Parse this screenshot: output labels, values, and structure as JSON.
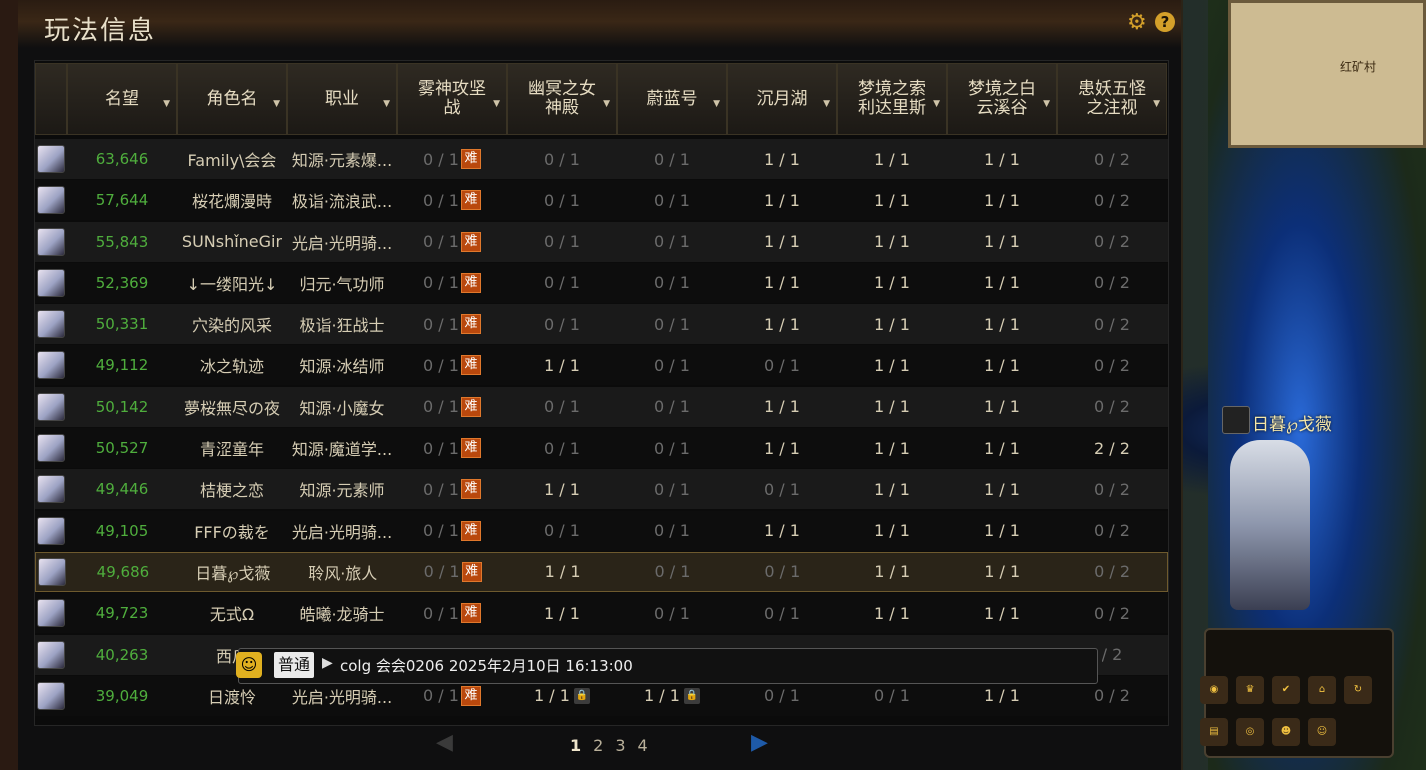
{
  "panel": {
    "title": "玩法信息",
    "gear_icon": "gear-icon",
    "help_label": "?"
  },
  "columns": [
    {
      "label": "",
      "sortable": false
    },
    {
      "label": "名望",
      "sortable": true
    },
    {
      "label": "角色名",
      "sortable": true
    },
    {
      "label": "职业",
      "sortable": true
    },
    {
      "label": "雾神攻坚战",
      "sortable": true
    },
    {
      "label": "幽冥之女神殿",
      "sortable": true
    },
    {
      "label": "蔚蓝号",
      "sortable": true
    },
    {
      "label": "沉月湖",
      "sortable": true
    },
    {
      "label": "梦境之索利达里斯",
      "sortable": true
    },
    {
      "label": "梦境之白云溪谷",
      "sortable": true
    },
    {
      "label": "患妖五怪之注视",
      "sortable": true
    }
  ],
  "rows": [
    {
      "fame": "63,646",
      "name": "Family\\会会",
      "job": "知源·元素爆...",
      "c1": "0 / 1",
      "c2": "0 / 1",
      "c3": "0 / 1",
      "c4": "1 / 1",
      "c5": "1 / 1",
      "c6": "1 / 1",
      "c7": "0 / 2"
    },
    {
      "fame": "57,644",
      "name": "桜花爛漫時",
      "job": "极诣·流浪武...",
      "c1": "0 / 1",
      "c2": "0 / 1",
      "c3": "0 / 1",
      "c4": "1 / 1",
      "c5": "1 / 1",
      "c6": "1 / 1",
      "c7": "0 / 2"
    },
    {
      "fame": "55,843",
      "name": "SUNshǐneGir",
      "job": "光启·光明骑...",
      "c1": "0 / 1",
      "c2": "0 / 1",
      "c3": "0 / 1",
      "c4": "1 / 1",
      "c5": "1 / 1",
      "c6": "1 / 1",
      "c7": "0 / 2"
    },
    {
      "fame": "52,369",
      "name": "↓一缕阳光↓",
      "job": "归元·气功师",
      "c1": "0 / 1",
      "c2": "0 / 1",
      "c3": "0 / 1",
      "c4": "1 / 1",
      "c5": "1 / 1",
      "c6": "1 / 1",
      "c7": "0 / 2"
    },
    {
      "fame": "50,331",
      "name": "穴染的风采",
      "job": "极诣·狂战士",
      "c1": "0 / 1",
      "c2": "0 / 1",
      "c3": "0 / 1",
      "c4": "1 / 1",
      "c5": "1 / 1",
      "c6": "1 / 1",
      "c7": "0 / 2"
    },
    {
      "fame": "49,112",
      "name": "冰之轨迹",
      "job": "知源·冰结师",
      "c1": "0 / 1",
      "c2": "1 / 1",
      "c3": "0 / 1",
      "c4": "0 / 1",
      "c5": "1 / 1",
      "c6": "1 / 1",
      "c7": "0 / 2"
    },
    {
      "fame": "50,142",
      "name": "夢桜無尽の夜",
      "job": "知源·小魔女",
      "c1": "0 / 1",
      "c2": "0 / 1",
      "c3": "0 / 1",
      "c4": "1 / 1",
      "c5": "1 / 1",
      "c6": "1 / 1",
      "c7": "0 / 2"
    },
    {
      "fame": "50,527",
      "name": "青涩童年",
      "job": "知源·魔道学...",
      "c1": "0 / 1",
      "c2": "0 / 1",
      "c3": "0 / 1",
      "c4": "1 / 1",
      "c5": "1 / 1",
      "c6": "1 / 1",
      "c7": "2 / 2"
    },
    {
      "fame": "49,446",
      "name": "桔梗之恋",
      "job": "知源·元素师",
      "c1": "0 / 1",
      "c2": "1 / 1",
      "c3": "0 / 1",
      "c4": "0 / 1",
      "c5": "1 / 1",
      "c6": "1 / 1",
      "c7": "0 / 2"
    },
    {
      "fame": "49,105",
      "name": "FFFの裁を",
      "job": "光启·光明骑...",
      "c1": "0 / 1",
      "c2": "0 / 1",
      "c3": "0 / 1",
      "c4": "1 / 1",
      "c5": "1 / 1",
      "c6": "1 / 1",
      "c7": "0 / 2"
    },
    {
      "fame": "49,686",
      "name": "日暮℘戈薇",
      "job": "聆风·旅人",
      "c1": "0 / 1",
      "c2": "1 / 1",
      "c3": "0 / 1",
      "c4": "0 / 1",
      "c5": "1 / 1",
      "c6": "1 / 1",
      "c7": "0 / 2"
    },
    {
      "fame": "49,723",
      "name": "无式Ω",
      "job": "皓曦·龙骑士",
      "c1": "0 / 1",
      "c2": "1 / 1",
      "c3": "0 / 1",
      "c4": "0 / 1",
      "c5": "1 / 1",
      "c6": "1 / 1",
      "c7": "0 / 2"
    },
    {
      "fame": "40,263",
      "name": "西瓜",
      "job": "",
      "c1": "",
      "c2": "",
      "c3": "",
      "c4": "",
      "c5": "",
      "c6": "",
      "c7": "/ 2"
    },
    {
      "fame": "39,049",
      "name": "日渡怜",
      "job": "光启·光明骑...",
      "c1": "0 / 1",
      "c2": "1 / 1",
      "c3": "1 / 1",
      "c4": "0 / 1",
      "c5": "0 / 1",
      "c6": "1 / 1",
      "c7": "0 / 2"
    }
  ],
  "badge_nan": "难",
  "selected_row": 10,
  "pager": {
    "pages": [
      "1",
      "2",
      "3",
      "4"
    ],
    "current": "1"
  },
  "chat": {
    "channel": "普通",
    "message": "colg 会会0206 2025年2月10日 16:13:00"
  },
  "right": {
    "map_label": "红矿村",
    "character_name": "日暮℘戈薇"
  },
  "colors": {
    "fame_green": "#4fae3d",
    "badge_orange": "#b9480d",
    "accent_gold": "#d4a02a"
  }
}
